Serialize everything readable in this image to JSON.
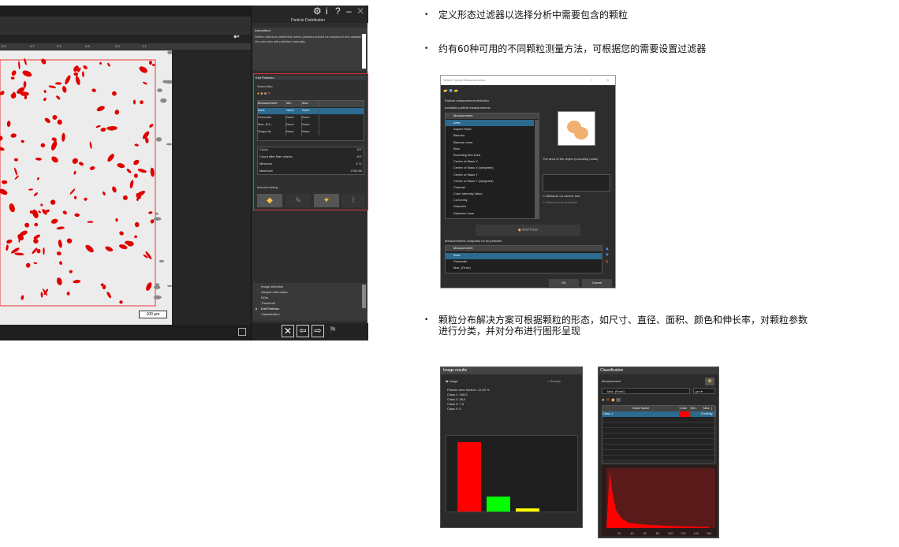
{
  "app": {
    "panel_title": "Particle Distribution",
    "top_icons": [
      "gear-icon",
      "info-icon",
      "help-icon",
      "minimize-icon",
      "close-icon"
    ],
    "ruler_ticks": [
      "0.0",
      "0.7",
      "0.3",
      "0.5",
      "0.3",
      "1.1"
    ],
    "zoom_label": "",
    "scale_bar": "100 µm",
    "instructions": {
      "title": "Instructions",
      "text": [
        "Define criteria to determine which particles should be included in the analysis.",
        "You can also edit particles manually."
      ]
    },
    "edit_particles": {
      "title": "Edit Particles",
      "subtitle": "Select filter",
      "columns": [
        "Measurement",
        "Min.",
        "Max."
      ],
      "rows": [
        {
          "name": "Area",
          "min": "None",
          "max": "None"
        },
        {
          "name": "Perimeter",
          "min": "None",
          "max": "None"
        },
        {
          "name": "Max. (Fe...",
          "min": "None",
          "max": "None"
        },
        {
          "name": "Shape fa...",
          "min": "None",
          "max": "None"
        }
      ],
      "stats": [
        {
          "label": "Count",
          "value": "107"
        },
        {
          "label": "Count after filter criteria",
          "value": "107"
        },
        {
          "label": "Minimum",
          "value": "0.71"
        },
        {
          "label": "Maximum",
          "value": "4760.85"
        }
      ],
      "manual_label": "Manual editing"
    },
    "workflow": [
      "Image selection",
      "Sample information",
      "ROIs",
      "Threshold",
      "Edit Particles",
      "Classification"
    ],
    "nav_buttons": [
      "close-icon",
      "back-arrow-icon",
      "forward-arrow-icon",
      "finish-flag-icon"
    ]
  },
  "bullets": [
    "定义形态过滤器以选择分析中需要包含的颗粒",
    "约有60种可用的不同颗粒测量方法，可根据您的需要设置过滤器",
    "颗粒分布解决方案可根据颗粒的形态，如尺寸、直径、面积、颜色和伸长率，对颗粒参数",
    "进行分类，并对分布进行图形呈现"
  ],
  "dialog": {
    "title": "Select Particle Measurements",
    "section1": "Particle measurement definition",
    "section2": "Available particle measurements",
    "list_header": "Measurement",
    "items": [
      "Area",
      "Aspect Ratio",
      "Bisector",
      "Bisector Inner",
      "Blue",
      "Bounding Box Area",
      "Center of Mass X",
      "Center of Mass X (weighted)",
      "Center of Mass Y",
      "Center of Mass Y (weighted)",
      "Channel",
      "Color Intensity Value",
      "Convexity",
      "Diameter",
      "Diameter Inner"
    ],
    "description": "The area of the object (excluding holes)",
    "checkbox1": "Measure on convex hull",
    "checkbox2": "Measure the grain/cell",
    "add_button": "Add Now",
    "section3": "Measurements computed for all particles",
    "computed_header": "Measurement",
    "computed": [
      "Area",
      "Perimeter",
      "Max. (Feret)"
    ],
    "ok": "OK",
    "cancel": "Cancel"
  },
  "image_results": {
    "title": "Image results",
    "radio_image": "Image",
    "radio_sample": "Sample",
    "lines": [
      "Particle area fraction: 12,83 %",
      "Class 1: 168,5",
      "Class 2: 36,5",
      "Class 3: 7,5",
      "Class 4: 0"
    ]
  },
  "classification": {
    "title": "Classification",
    "measurement_label": "Measurement",
    "measurement_value": "Max. (Feret)",
    "unit": "µm",
    "columns": [
      "Class Name",
      "Color",
      "Min.",
      "Max. ["
    ],
    "rows": [
      {
        "name": "Class 1",
        "min": "0",
        "max": "Infinity"
      }
    ],
    "axis_ticks": [
      "20",
      "40",
      "60",
      "80",
      "100",
      "120",
      "140",
      "160"
    ]
  },
  "chart_data": [
    {
      "type": "bar",
      "categories": [
        "Class 1",
        "Class 2",
        "Class 3",
        "Class 4"
      ],
      "values": [
        168.5,
        36.5,
        7.5,
        0
      ],
      "colors": [
        "#ff0000",
        "#00ff00",
        "#ffff00",
        "#0000ff"
      ],
      "title": "",
      "xlabel": "",
      "ylabel": ""
    },
    {
      "type": "area",
      "x": [
        5,
        10,
        15,
        20,
        25,
        30,
        35,
        40,
        50,
        60,
        70,
        80,
        90,
        100,
        110,
        120,
        130,
        140,
        150,
        160
      ],
      "values": [
        95,
        55,
        30,
        22,
        15,
        12,
        9,
        8,
        7,
        6,
        5,
        5,
        4,
        4,
        3,
        3,
        3,
        2,
        2,
        2
      ],
      "xlabel": "",
      "ylabel": ""
    }
  ]
}
